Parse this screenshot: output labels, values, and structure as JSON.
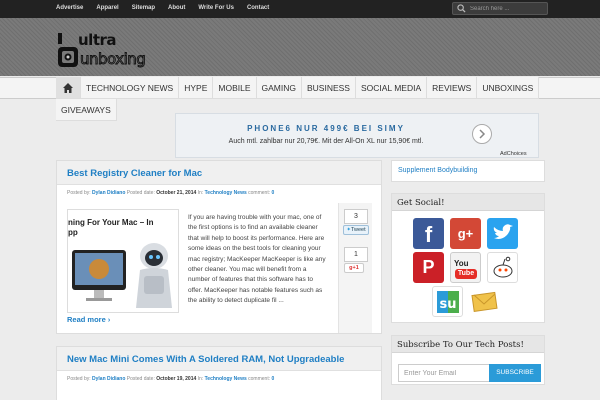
{
  "topbar": {
    "links": [
      "Advertise",
      "Apparel",
      "Sitemap",
      "About",
      "Write For Us",
      "Contact"
    ],
    "search_placeholder": "Search here ..."
  },
  "header": {
    "logo_text_top": "ultra",
    "logo_text_bottom": "unboxing"
  },
  "nav": {
    "items": [
      "TECHNOLOGY NEWS",
      "HYPE",
      "MOBILE",
      "GAMING",
      "BUSINESS",
      "SOCIAL MEDIA",
      "REVIEWS",
      "UNBOXINGS",
      "GIVEAWAYS"
    ]
  },
  "ad": {
    "line1": "PHONE6 NUR 499€ BEI SIMY",
    "line2": "Auch mtl. zahlbar nur 20,79€. Mit der All-On XL nur 15,90€ mtl.",
    "adchoices": "AdChoices"
  },
  "posts": [
    {
      "title": "Best Registry Cleaner for Mac",
      "posted_by_label": "Posted by:",
      "author": "Dylan Didiano",
      "posted_date_label": "Posted date:",
      "date": "October 21, 2014",
      "in_label": "In:",
      "category": "Technology News",
      "comment_label": "comment:",
      "comments": "0",
      "thumb_title_1": "ning For Your Mac – In",
      "thumb_title_2": "pp",
      "excerpt": "If you are having trouble with your mac, one of the first options is to find an available cleaner that will help to boost its performance. Here are some ideas on the best tools for cleaning your mac registry; MacKeeper MacKeeper is like any other cleaner. You mac will benefit from a number of features that this software has to offer. MacKeeper has notable features such as the ability to detect duplicate fil ...",
      "read_more": "Read more",
      "tweet_count": "3",
      "tweet_label": "Tweet",
      "gplus_count": "1",
      "gplus_label": "g+1"
    },
    {
      "title": "New Mac Mini Comes With A Soldered RAM, Not Upgradeable",
      "posted_by_label": "Posted by:",
      "author": "Dylan Didiano",
      "posted_date_label": "Posted date:",
      "date": "October 19, 2014",
      "in_label": "In:",
      "category": "Technology News",
      "comment_label": "comment:",
      "comments": "0"
    }
  ],
  "sidebar": {
    "link": "Supplement Bodybuilding",
    "social_title": "Get Social!",
    "social_icons": [
      "facebook-icon",
      "google-plus-icon",
      "twitter-icon",
      "pinterest-icon",
      "youtube-icon",
      "reddit-icon",
      "stumbleupon-icon",
      "email-icon"
    ],
    "subscribe_title": "Subscribe To Our Tech Posts!",
    "email_placeholder": "Enter Your Email",
    "subscribe_button": "SUBSCRIBE"
  },
  "colors": {
    "accent": "#1f7fc4",
    "topbar": "#222222",
    "subscribe": "#2b9bd8"
  }
}
